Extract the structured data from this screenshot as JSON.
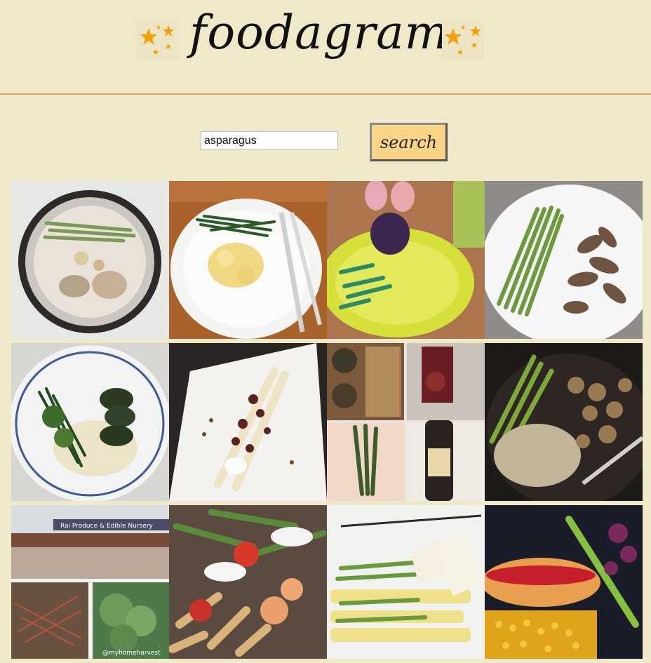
{
  "app": {
    "logo_text": "foodagram"
  },
  "search": {
    "value": "asparagus",
    "button_label": "search"
  },
  "colors": {
    "background": "#efe9c9",
    "divider": "#e0a64a",
    "button": "#f9d487",
    "star": "#f5a000"
  },
  "results": [
    {
      "name": "asparagus-noodle-bowl-photo"
    },
    {
      "name": "green-beans-scrambled-eggs-photo"
    },
    {
      "name": "eggs-asparagus-yellow-plate-photo"
    },
    {
      "name": "asparagus-beef-strips-photo"
    },
    {
      "name": "green-beans-meatballs-mash-photo"
    },
    {
      "name": "white-asparagus-plated-photo"
    },
    {
      "name": "asparagus-wine-collage-photo"
    },
    {
      "name": "asparagus-chicken-rice-photo"
    },
    {
      "name": "produce-nursery-collage-photo",
      "sign_text": "Rai Produce & Edible Nursery",
      "watermark": "@myhomeharvest"
    },
    {
      "name": "penne-shrimp-asparagus-photo"
    },
    {
      "name": "asparagus-shaved-cheese-photo"
    },
    {
      "name": "hotdog-corn-asparagus-photo"
    }
  ]
}
